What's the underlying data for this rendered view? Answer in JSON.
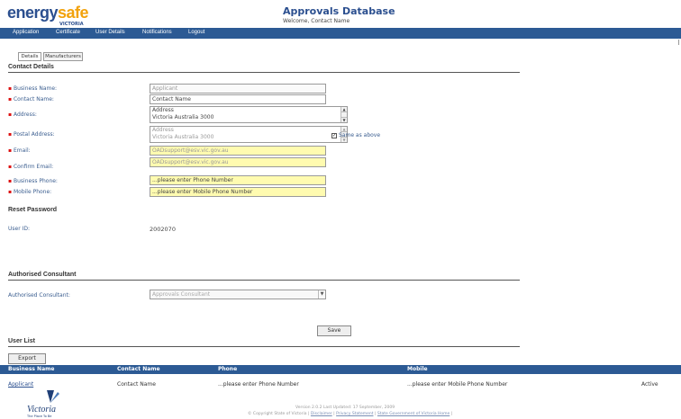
{
  "brand": {
    "logo_energy": "energy",
    "logo_safe": "safe",
    "logo_sub": "VICTORIA"
  },
  "header": {
    "title": "Approvals Database",
    "welcome": "Welcome, Contact Name"
  },
  "nav": [
    "Application",
    "Certificate",
    "User Details",
    "Notifications",
    "Logout"
  ],
  "tabs": [
    "Details",
    "Manufacturers"
  ],
  "contact": {
    "section_title": "Contact Details",
    "business_name": {
      "label": "Business Name:",
      "value": "Applicant"
    },
    "contact_name": {
      "label": "Contact Name:",
      "value": "Contact Name"
    },
    "address": {
      "label": "Address:",
      "line1": "Address",
      "line2": "Victoria Australia 3000"
    },
    "postal_address": {
      "label": "Postal Address:",
      "line1": "Address",
      "line2": "Victoria Australia 3000"
    },
    "same_as_above": "Same as above",
    "email": {
      "label": "Email:",
      "value": "OADsupport@esv.vic.gov.au"
    },
    "confirm_email": {
      "label": "Confirm Email:",
      "value": "OADsupport@esv.vic.gov.au"
    },
    "business_phone": {
      "label": "Business Phone:",
      "value": "...please enter Phone Number"
    },
    "mobile_phone": {
      "label": "Mobile Phone:",
      "value": "...please enter Mobile Phone Number"
    }
  },
  "reset": {
    "section_title": "Reset Password",
    "user_id_label": "User ID:",
    "user_id": "2002070"
  },
  "consultant": {
    "section_title": "Authorised Consultant",
    "label": "Authorised Consultant:",
    "value": "Approvals Consultant"
  },
  "save_label": "Save",
  "user_list": {
    "section_title": "User List",
    "export_label": "Export",
    "columns": [
      "Business Name",
      "Contact Name",
      "Phone",
      "Mobile"
    ],
    "rows": [
      {
        "business": "Applicant",
        "contact": "Contact Name",
        "phone": "...please enter Phone Number",
        "mobile": "...please enter Mobile Phone Number",
        "status": "Active"
      }
    ]
  },
  "footer": {
    "version": "Version 2.0.2  Last Updated: 17 September, 2009",
    "copyright": "© Copyright State of Victoria |",
    "links": [
      "Disclaimer",
      "Privacy Statement",
      "State Government of Victoria Home"
    ],
    "victoria": "Victoria",
    "victoria_tag": "The Place To Be"
  }
}
